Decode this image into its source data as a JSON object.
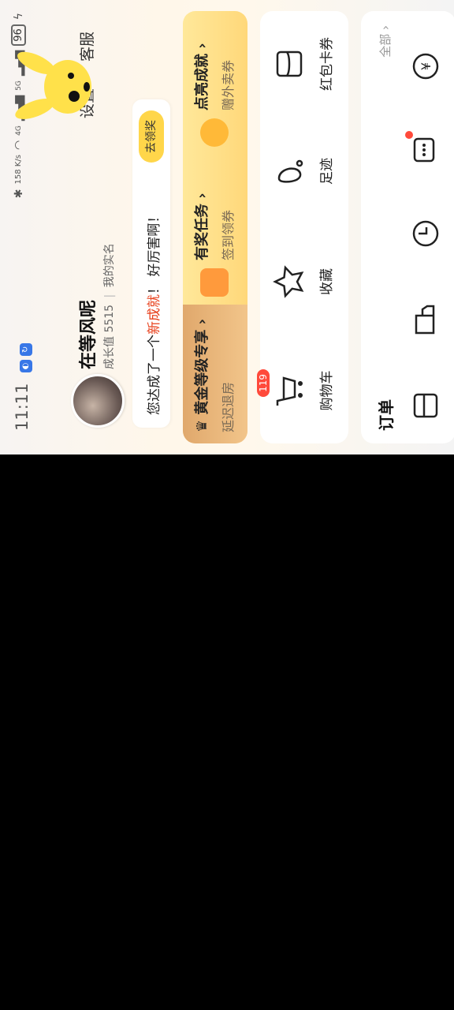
{
  "status_bar": {
    "time": "11:11",
    "network_speed": "158 K/s",
    "signal_1": "4G",
    "signal_2": "5G",
    "battery": "96"
  },
  "header": {
    "username": "在等风呢",
    "growth_label": "成长值",
    "growth_value": "5515",
    "verify_text": "我的实名",
    "settings_label": "设置",
    "service_label": "客服"
  },
  "achievement": {
    "text_before": "您达成了一个",
    "highlight": "新成就",
    "text_after": "！ 好厉害啊！",
    "button": "去领奖"
  },
  "rewards": {
    "gold": {
      "title": "黄金等级专享",
      "subtitle": "延迟退房"
    },
    "task": {
      "title": "有奖任务",
      "subtitle": "签到领券"
    },
    "achieve": {
      "title": "点亮成就",
      "subtitle": "赠外卖券"
    }
  },
  "shortcuts": [
    {
      "label": "购物车",
      "icon": "cart-icon",
      "badge": "119"
    },
    {
      "label": "收藏",
      "icon": "star-icon"
    },
    {
      "label": "足迹",
      "icon": "footprint-icon"
    },
    {
      "label": "红包卡券",
      "icon": "coupon-icon"
    }
  ],
  "orders": {
    "title": "订单",
    "all_label": "全部",
    "items": [
      {
        "icon": "wallet-icon"
      },
      {
        "icon": "delivery-icon"
      },
      {
        "icon": "clock-icon"
      },
      {
        "icon": "chat-review-icon"
      },
      {
        "icon": "refund-icon"
      }
    ]
  },
  "colors": {
    "accent_yellow": "#ffd64a",
    "highlight_red": "#e8401c",
    "gold": "#e0a86c",
    "badge_red": "#ff4a3b"
  }
}
